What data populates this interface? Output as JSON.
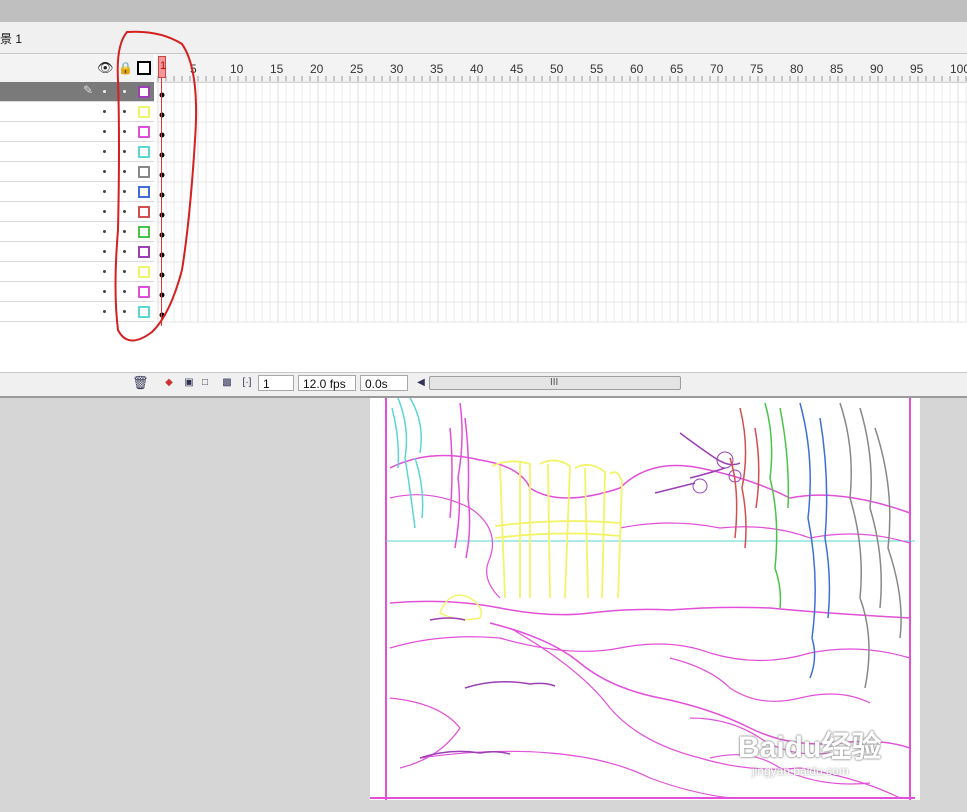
{
  "scene": {
    "label": "景 1"
  },
  "timeline": {
    "ruler_labels": [
      "1",
      "5",
      "10",
      "15",
      "20",
      "25",
      "30",
      "35",
      "40",
      "45",
      "50",
      "55",
      "60",
      "65",
      "70",
      "75",
      "80",
      "85",
      "90",
      "95",
      "100"
    ],
    "layers": [
      {
        "outline_color": "#9b3fb5",
        "selected": true
      },
      {
        "outline_color": "#f3f36a"
      },
      {
        "outline_color": "#e24fd8"
      },
      {
        "outline_color": "#5ad6d6"
      },
      {
        "outline_color": "#888888"
      },
      {
        "outline_color": "#3f6fd6"
      },
      {
        "outline_color": "#d64c4c"
      },
      {
        "outline_color": "#48c448"
      },
      {
        "outline_color": "#9b3fb5"
      },
      {
        "outline_color": "#f3f36a"
      },
      {
        "outline_color": "#e24fd8"
      },
      {
        "outline_color": "#5ad6d6"
      }
    ]
  },
  "status": {
    "frame": "1",
    "fps": "12.0 fps",
    "time": "0.0s",
    "scroll_grip": "III"
  },
  "icons": {
    "eye": "eye-icon",
    "lock": "lock-icon",
    "outline": "outline-icon",
    "pencil": "pencil-icon",
    "trash": "trash-icon",
    "onion": "onion-skin-icon"
  },
  "annotation": {
    "color": "#d42020"
  },
  "watermark": {
    "text": "Baidu经验",
    "sub": "jingyan.baidu.com"
  }
}
